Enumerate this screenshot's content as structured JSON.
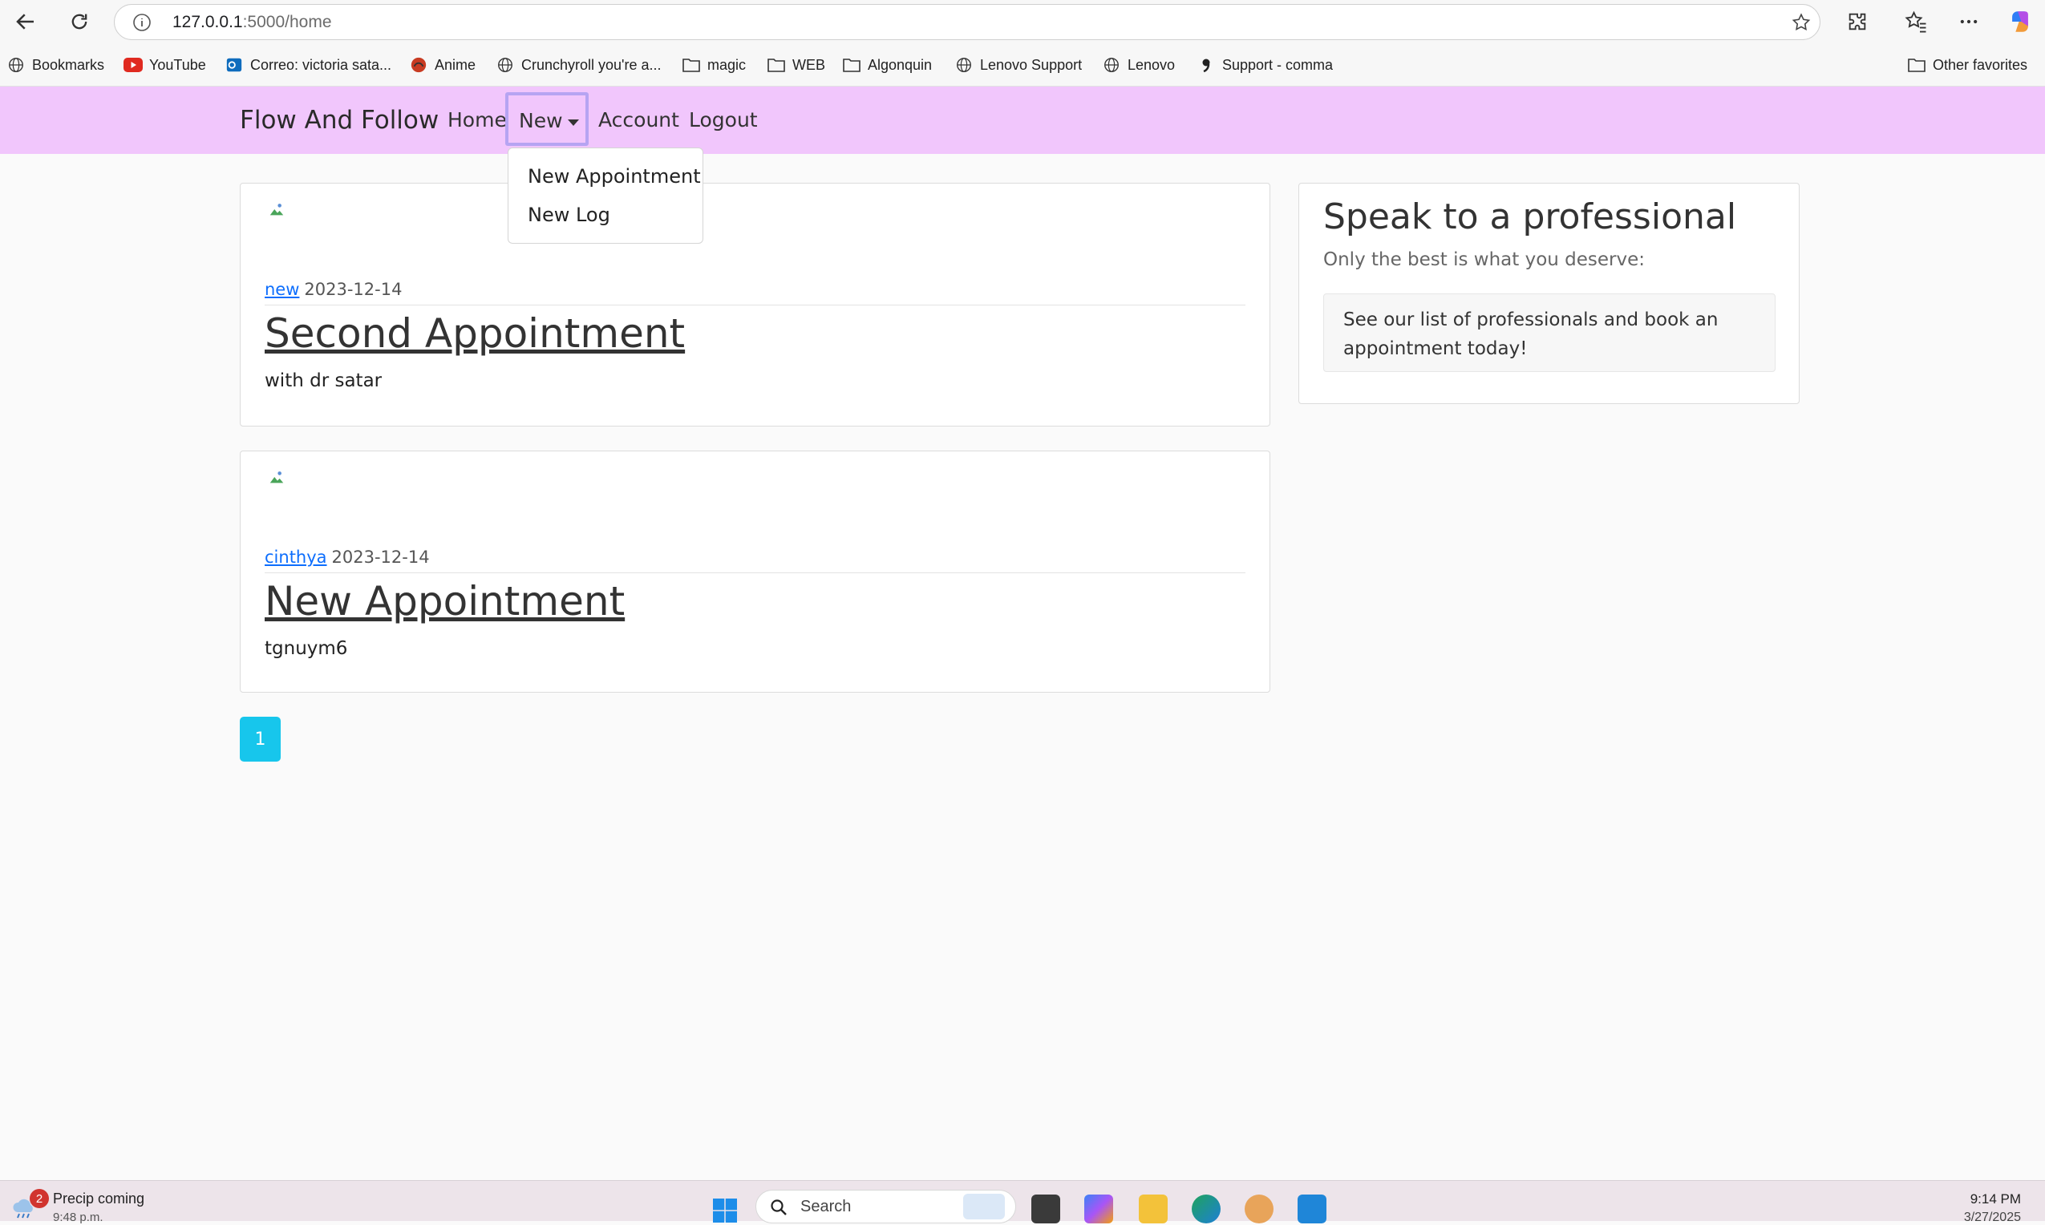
{
  "browser": {
    "url_host": "127.0.0.1",
    "url_path": ":5000/home",
    "bookmarks": [
      {
        "label": "Bookmarks",
        "icon": "globe-icon"
      },
      {
        "label": "YouTube",
        "icon": "youtube-icon"
      },
      {
        "label": "Correo: victoria sata...",
        "icon": "outlook-icon"
      },
      {
        "label": "Anime",
        "icon": "anime-site-icon"
      },
      {
        "label": "Crunchyroll you're a...",
        "icon": "globe-icon"
      },
      {
        "label": "magic",
        "icon": "folder-icon"
      },
      {
        "label": "WEB",
        "icon": "folder-icon"
      },
      {
        "label": "Algonquin",
        "icon": "folder-icon"
      },
      {
        "label": "Lenovo Support",
        "icon": "globe-icon"
      },
      {
        "label": "Lenovo",
        "icon": "globe-icon"
      },
      {
        "label": "Support - comma",
        "icon": "comma-icon"
      }
    ],
    "other_favorites": "Other favorites"
  },
  "navbar": {
    "brand": "Flow And Follow",
    "home": "Home",
    "new": "New",
    "account": "Account",
    "logout": "Logout",
    "dropdown": [
      "New Appointment",
      "New Log"
    ],
    "bg_color": "#f1c6fc"
  },
  "posts": [
    {
      "author": "new",
      "date": "2023-12-14",
      "title": "Second Appointment",
      "content": "with dr satar"
    },
    {
      "author": "cinthya",
      "date": "2023-12-14",
      "title": "New Appointment",
      "content": "tgnuym6"
    }
  ],
  "pagination": {
    "current": "1",
    "color": "#17c6ec"
  },
  "sidebar": {
    "title": "Speak to a professional",
    "subtitle": "Only the best is what you deserve:",
    "box_text": "See our list of professionals and book an appointment today!"
  },
  "taskbar": {
    "weather": "Precip coming",
    "weather_sub": "9:48 p.m.",
    "badge": "2",
    "search": "Search",
    "time": "9:14 PM",
    "date": "3/27/2025"
  }
}
